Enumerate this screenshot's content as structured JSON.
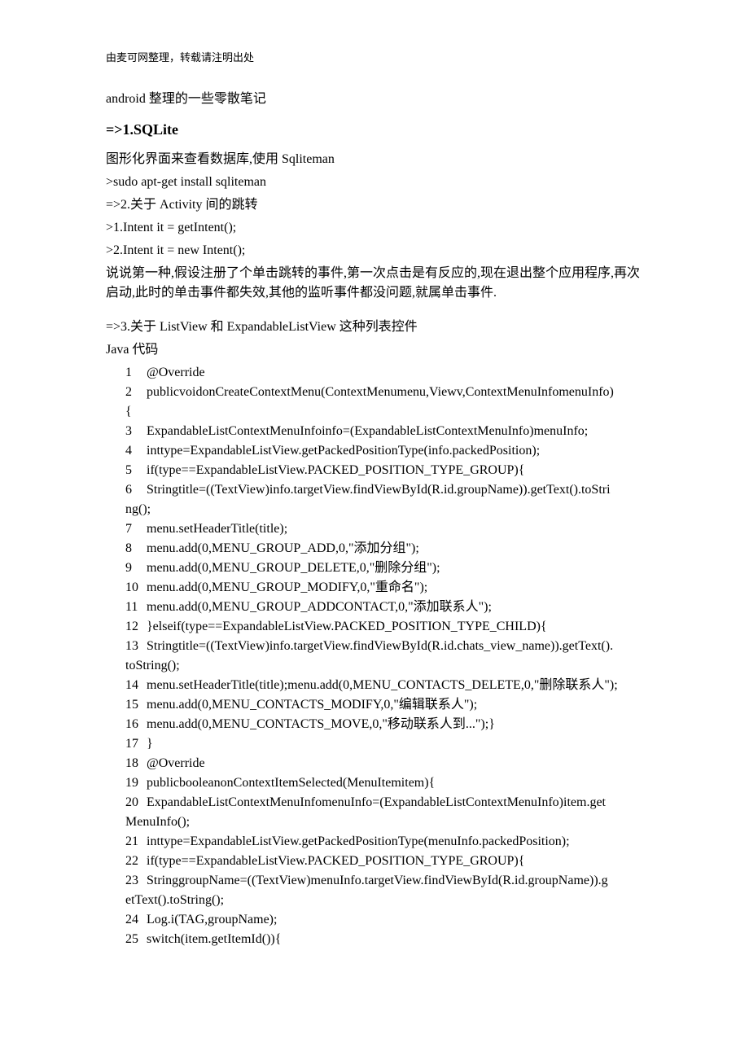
{
  "header_note": "由麦可网整理，转载请注明出处",
  "title": "android 整理的一些零散笔记",
  "section_heading": "=>1.SQLite",
  "body": {
    "p1": "图形化界面来查看数据库,使用 Sqliteman",
    "p2": ">sudo apt-get install sqliteman",
    "p3": "=>2.关于 Activity 间的跳转",
    "p4": ">1.Intent it = getIntent();",
    "p5": ">2.Intent it = new Intent();",
    "p6": "说说第一种,假设注册了个单击跳转的事件,第一次点击是有反应的,现在退出整个应用程序,再次启动,此时的单击事件都失效,其他的监听事件都没问题,就属单击事件.",
    "p7": "=>3.关于 ListView  和  ExpandableListView 这种列表控件",
    "java_label": "Java 代码"
  },
  "code_lines": [
    {
      "n": "1",
      "c": "@Override"
    },
    {
      "n": "2",
      "c": "publicvoidonCreateContextMenu(ContextMenumenu,Viewv,ContextMenuInfomenuInfo)",
      "wrap": "{"
    },
    {
      "n": "3",
      "c": "ExpandableListContextMenuInfoinfo=(ExpandableListContextMenuInfo)menuInfo;"
    },
    {
      "n": "4",
      "c": "inttype=ExpandableListView.getPackedPositionType(info.packedPosition);"
    },
    {
      "n": "5",
      "c": "if(type==ExpandableListView.PACKED_POSITION_TYPE_GROUP){"
    },
    {
      "n": "6",
      "c": "Stringtitle=((TextView)info.targetView.findViewById(R.id.groupName)).getText().toStri",
      "wrap": "ng();"
    },
    {
      "n": "7",
      "c": "menu.setHeaderTitle(title);"
    },
    {
      "n": "8",
      "c": "menu.add(0,MENU_GROUP_ADD,0,\"添加分组\");"
    },
    {
      "n": "9",
      "c": "menu.add(0,MENU_GROUP_DELETE,0,\"删除分组\");"
    },
    {
      "n": "10",
      "c": "menu.add(0,MENU_GROUP_MODIFY,0,\"重命名\");"
    },
    {
      "n": "11",
      "c": "menu.add(0,MENU_GROUP_ADDCONTACT,0,\"添加联系人\");"
    },
    {
      "n": "12",
      "c": "}elseif(type==ExpandableListView.PACKED_POSITION_TYPE_CHILD){"
    },
    {
      "n": "13",
      "c": "Stringtitle=((TextView)info.targetView.findViewById(R.id.chats_view_name)).getText().",
      "wrap": "toString();"
    },
    {
      "n": "14",
      "c": "menu.setHeaderTitle(title);menu.add(0,MENU_CONTACTS_DELETE,0,\"删除联系人\");"
    },
    {
      "n": "15",
      "c": "menu.add(0,MENU_CONTACTS_MODIFY,0,\"编辑联系人\");"
    },
    {
      "n": "16",
      "c": "menu.add(0,MENU_CONTACTS_MOVE,0,\"移动联系人到...\");}"
    },
    {
      "n": "17",
      "c": "}"
    },
    {
      "n": "18",
      "c": "@Override"
    },
    {
      "n": "19",
      "c": "publicbooleanonContextItemSelected(MenuItemitem){"
    },
    {
      "n": "20",
      "c": "ExpandableListContextMenuInfomenuInfo=(ExpandableListContextMenuInfo)item.get",
      "wrap": "MenuInfo();"
    },
    {
      "n": "21",
      "c": "inttype=ExpandableListView.getPackedPositionType(menuInfo.packedPosition);"
    },
    {
      "n": "22",
      "c": "if(type==ExpandableListView.PACKED_POSITION_TYPE_GROUP){"
    },
    {
      "n": "23",
      "c": "StringgroupName=((TextView)menuInfo.targetView.findViewById(R.id.groupName)).g",
      "wrap": "etText().toString();"
    },
    {
      "n": "24",
      "c": "Log.i(TAG,groupName);"
    },
    {
      "n": "25",
      "c": "switch(item.getItemId()){"
    }
  ]
}
